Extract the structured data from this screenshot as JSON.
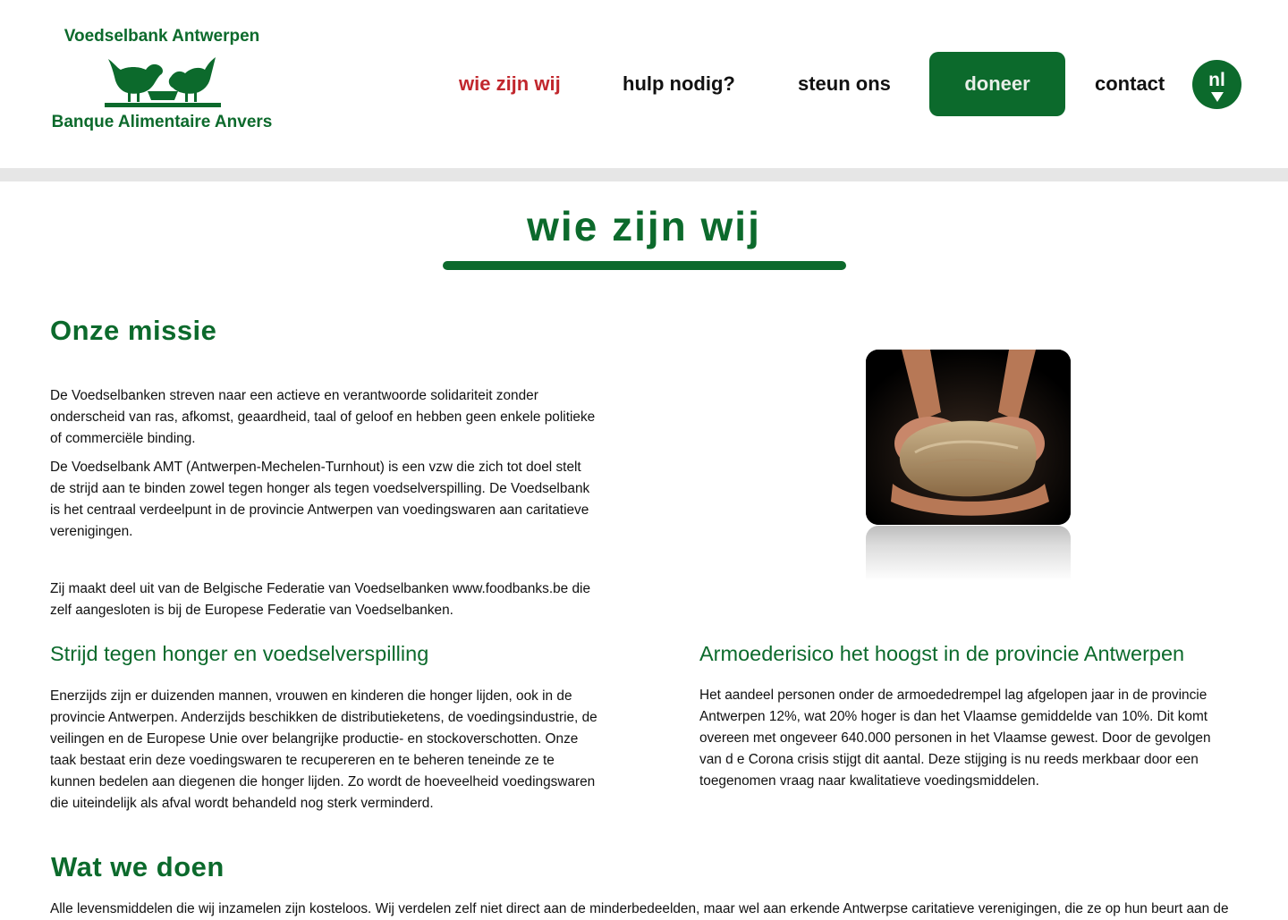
{
  "brand": {
    "name_nl": "Voedselbank Antwerpen",
    "name_fr": "Banque Alimentaire Anvers",
    "color": "#0c6a2c",
    "logo_icon": "two-birds-eating-icon"
  },
  "nav": {
    "items": [
      {
        "label": "wie zijn wij",
        "active": true
      },
      {
        "label": "hulp nodig?"
      },
      {
        "label": "steun ons"
      },
      {
        "label": "doneer"
      },
      {
        "label": "contact"
      }
    ],
    "language": "nl",
    "active_color": "#c1272d"
  },
  "page": {
    "title": "wie zijn wij"
  },
  "sections": {
    "missie": {
      "heading": "Onze missie",
      "p1": "De Voedselbanken streven naar een actieve en verantwoorde solidariteit zonder onderscheid van ras, afkomst, geaardheid, taal of geloof en hebben geen enkele politieke of commerciële binding.",
      "p2": "De Voedselbank AMT (Antwerpen-Mechelen-Turnhout) is een vzw die zich tot doel stelt de strijd aan te binden zowel tegen honger als tegen voedselverspilling. De Voedselbank is het centraal verdeelpunt in de provincie Antwerpen van voedingswaren aan caritatieve verenigingen.",
      "p3": "Zij maakt deel uit van de Belgische Federatie van Voedselbanken www.foodbanks.be die zelf aangesloten is bij de Europese Federatie van Voedselbanken.",
      "image_icon": "bread-in-hands-image"
    },
    "strijd": {
      "heading": "Strijd tegen honger en voedselverspilling",
      "text": "Enerzijds zijn er duizenden mannen, vrouwen en kinderen die honger lijden, ook in de provincie Antwerpen. Anderzijds beschikken de distributieketens, de voedingsindustrie, de veilingen en de Europese Unie over belangrijke productie- en stockoverschotten. Onze taak bestaat erin deze voedingswaren te recupereren en te beheren teneinde ze te kunnen bedelen aan diegenen die honger lijden. Zo wordt de hoeveelheid voedingswaren die uiteindelijk als afval wordt behandeld nog sterk verminderd."
    },
    "armoede": {
      "heading": "Armoederisico het hoogst in de provincie Antwerpen",
      "text": "Het aandeel personen onder de armoededrempel lag afgelopen jaar in de provincie Antwerpen 12%, wat 20% hoger is dan het Vlaamse gemiddelde van 10%. Dit komt overeen met ongeveer 640.000 personen in het Vlaamse gewest. Door de gevolgen van d e Corona crisis stijgt dit aantal. Deze stijging is nu reeds merkbaar door een toegenomen vraag naar kwalitatieve voedingsmiddelen."
    },
    "wat": {
      "heading": "Wat we doen",
      "text": "Alle levensmiddelen die wij inzamelen zijn kosteloos. Wij verdelen zelf niet direct aan de minderbedeelden, maar wel aan erkende Antwerpse caritatieve verenigingen, die ze op hun beurt aan de"
    }
  }
}
